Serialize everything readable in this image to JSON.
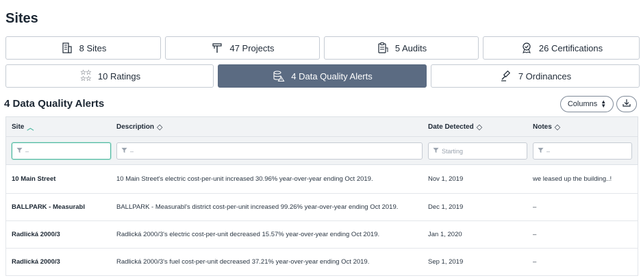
{
  "page": {
    "title": "Sites"
  },
  "tabs_row1": [
    {
      "label": "8 Sites",
      "icon": "building-icon"
    },
    {
      "label": "47 Projects",
      "icon": "tools-icon"
    },
    {
      "label": "5 Audits",
      "icon": "clipboard-icon"
    },
    {
      "label": "26 Certifications",
      "icon": "badge-icon"
    }
  ],
  "tabs_row2": [
    {
      "label": "10 Ratings",
      "icon": "stars-icon"
    },
    {
      "label": "4 Data Quality Alerts",
      "icon": "database-alert-icon",
      "active": true
    },
    {
      "label": "7 Ordinances",
      "icon": "gavel-icon"
    }
  ],
  "section": {
    "title": "4 Data Quality Alerts"
  },
  "toolbar": {
    "columns_label": "Columns"
  },
  "table": {
    "headers": [
      "Site",
      "Description",
      "Date Detected",
      "Notes"
    ],
    "filters": [
      {
        "placeholder": "–"
      },
      {
        "placeholder": "–"
      },
      {
        "placeholder": "Starting"
      },
      {
        "placeholder": "–"
      }
    ],
    "rows": [
      {
        "site": "10 Main Street",
        "description": "10 Main Street's electric cost-per-unit increased 30.96% year-over-year ending Oct 2019.",
        "date": "Nov 1, 2019",
        "notes": "we leased up the building..!"
      },
      {
        "site": "BALLPARK - Measurabl",
        "description": "BALLPARK - Measurabl's district cost-per-unit increased 99.26% year-over-year ending Oct 2019.",
        "date": "Dec 1, 2019",
        "notes": "–"
      },
      {
        "site": "Radlická 2000/3",
        "description": "Radlická 2000/3's electric cost-per-unit decreased 15.57% year-over-year ending Oct 2019.",
        "date": "Jan 1, 2020",
        "notes": "–"
      },
      {
        "site": "Radlická 2000/3",
        "description": "Radlická 2000/3's fuel cost-per-unit decreased 37.21% year-over-year ending Oct 2019.",
        "date": "Sep 1, 2019",
        "notes": "–"
      }
    ]
  },
  "colors": {
    "active_tab": "#5b6b82",
    "accent": "#4fb8a1",
    "border": "#c5cbd3"
  }
}
